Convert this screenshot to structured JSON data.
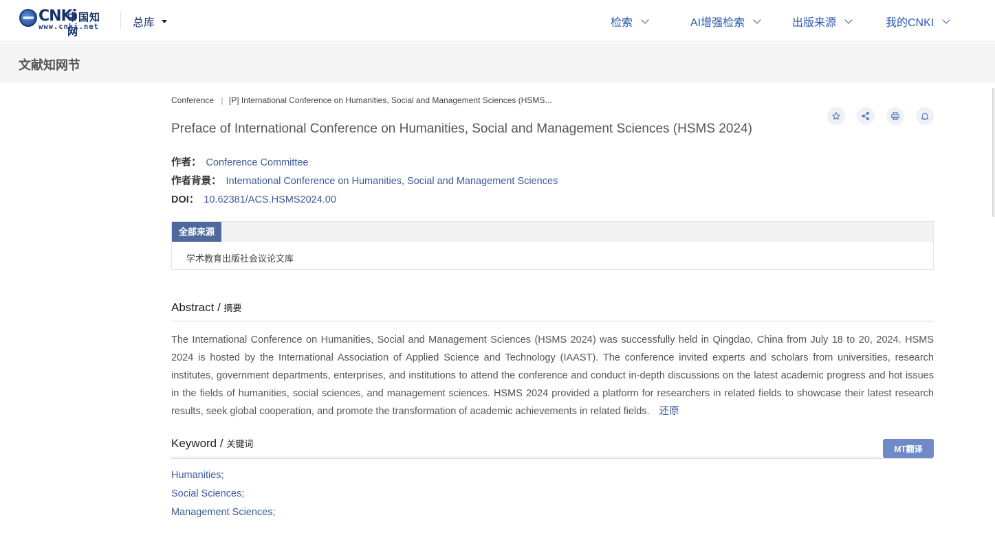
{
  "header": {
    "logo_text": "CNKi",
    "logo_cn": "中国知网",
    "logo_url": "www.cnki.net",
    "library": "总库",
    "nav": [
      {
        "label": "检索"
      },
      {
        "label": "AI增强检索"
      },
      {
        "label": "出版来源"
      },
      {
        "label": "我的CNKI"
      }
    ]
  },
  "subheader": {
    "title": "文献知网节"
  },
  "article": {
    "breadcrumb_type": "Conference",
    "breadcrumb_sep": "|",
    "breadcrumb_source": "[P] International Conference on Humanities, Social and Management Sciences (HSMS...",
    "title": "Preface of International Conference on Humanities, Social and Management Sciences (HSMS 2024)",
    "author_label": "作者：",
    "author": "Conference Committee",
    "background_label": "作者背景：",
    "background": "International Conference on Humanities, Social and Management Sciences",
    "doi_label": "DOI：",
    "doi": "10.62381/ACS.HSMS2024.00"
  },
  "actions": [
    {
      "icon": "star-icon"
    },
    {
      "icon": "share-icon"
    },
    {
      "icon": "print-icon"
    },
    {
      "icon": "bell-icon"
    }
  ],
  "sources": {
    "tab_label": "全部来源",
    "item": "学术教育出版社会议论文库"
  },
  "abstract": {
    "title_en": "Abstract",
    "title_sep": " / ",
    "title_cn": "摘要",
    "text": "The International Conference on Humanities, Social and Management Sciences (HSMS 2024) was successfully held in Qingdao, China from July 18 to 20, 2024. HSMS 2024 is hosted by the International Association of Applied Science and Technology (IAAST). The conference invited experts and scholars from universities, research institutes, government departments, enterprises, and institutions to attend the conference and conduct in-depth discussions on the latest academic progress and hot issues in the fields of humanities, social sciences, and management sciences. HSMS 2024 provided a platform for researchers in related fields to showcase their latest research results, seek global cooperation, and promote the transformation of academic achievements in related fields.",
    "restore_label": "还原"
  },
  "keywords": {
    "title_en": "Keyword",
    "title_sep": " / ",
    "title_cn": "关键词",
    "mt_label": "MT翻译",
    "items": [
      "Humanities;",
      "Social Sciences;",
      "Management Sciences;"
    ]
  },
  "colors": {
    "link": "#3d5a99",
    "nav": "#2a57b0",
    "tab": "#4e6a9c",
    "button": "#6f8ac4"
  }
}
